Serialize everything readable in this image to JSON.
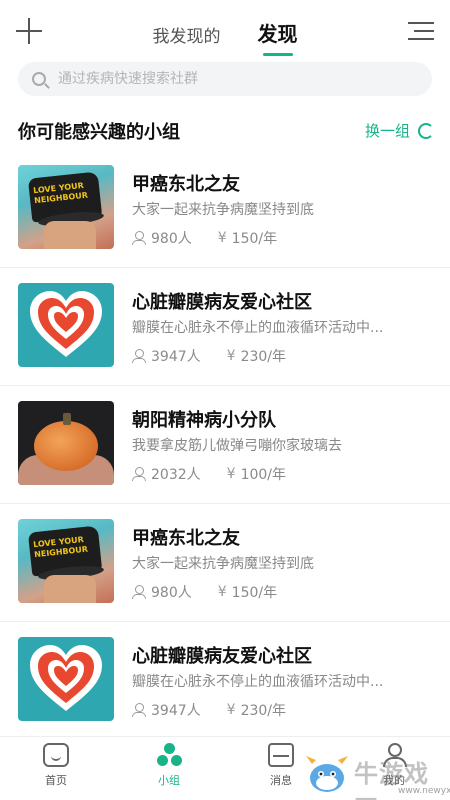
{
  "header": {
    "tabs": [
      {
        "label": "我发现的",
        "active": false
      },
      {
        "label": "发现",
        "active": true
      }
    ],
    "add_icon": "plus-icon",
    "menu_icon": "menu-icon"
  },
  "search": {
    "placeholder": "通过疾病快速搜索社群",
    "value": ""
  },
  "section": {
    "title": "你可能感兴趣的小组",
    "refresh_label": "换一组"
  },
  "groups": [
    {
      "name": "甲癌东北之友",
      "desc": "大家一起来抗争病魔坚持到底",
      "members": "980人",
      "price": "150/年",
      "thumb": "cap",
      "thumb_text": "LOVE YOUR NEIGHBOUR"
    },
    {
      "name": "心脏瓣膜病友爱心社区",
      "desc": "瓣膜在心脏永不停止的血液循环活动中...",
      "members": "3947人",
      "price": "230/年",
      "thumb": "heart"
    },
    {
      "name": "朝阳精神病小分队",
      "desc": "我要拿皮筋儿做弹弓嘣你家玻璃去",
      "members": "2032人",
      "price": "100/年",
      "thumb": "pumpkin"
    },
    {
      "name": "甲癌东北之友",
      "desc": "大家一起来抗争病魔坚持到底",
      "members": "980人",
      "price": "150/年",
      "thumb": "cap",
      "thumb_text": "LOVE YOUR NEIGHBOUR"
    },
    {
      "name": "心脏瓣膜病友爱心社区",
      "desc": "瓣膜在心脏永不停止的血液循环活动中...",
      "members": "3947人",
      "price": "230/年",
      "thumb": "heart"
    }
  ],
  "currency_symbol": "¥",
  "bottom_nav": [
    {
      "label": "首页",
      "icon": "home-icon",
      "active": false
    },
    {
      "label": "小组",
      "icon": "group-icon",
      "active": true
    },
    {
      "label": "消息",
      "icon": "message-icon",
      "active": false
    },
    {
      "label": "我的",
      "icon": "profile-icon",
      "active": false
    }
  ],
  "watermark": {
    "text": "牛游戏网",
    "url": "www.newyx.net"
  },
  "colors": {
    "accent": "#17b389",
    "text_primary": "#111111",
    "text_secondary": "#888888",
    "search_bg": "#f3f4f6"
  }
}
